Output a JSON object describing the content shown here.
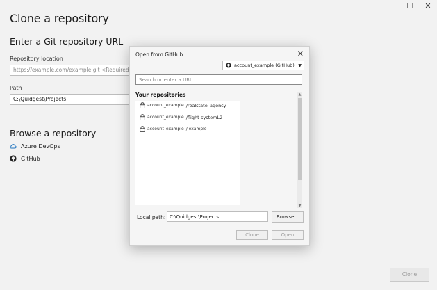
{
  "window": {
    "title": "Clone a repository",
    "minimize_glyph": "☐",
    "close_glyph": "✕"
  },
  "url_section": {
    "heading": "Enter a Git repository URL",
    "repo_location_label": "Repository location",
    "repo_location_placeholder": "https://example.com/example.git <Required>",
    "path_label": "Path",
    "path_value": "C:\\Quidgest\\Projects"
  },
  "browse_section": {
    "heading": "Browse a repository",
    "items": [
      {
        "label": "Azure DevOps",
        "icon": "cloud-icon"
      },
      {
        "label": "GitHub",
        "icon": "github-icon"
      }
    ]
  },
  "clone_button_label": "Clone",
  "dialog": {
    "title": "Open from GitHub",
    "account_selector": "account_example (GitHub)",
    "search_placeholder": "Search or enter a URL",
    "repositories_heading": "Your repositories",
    "repositories": [
      {
        "owner": "account_example",
        "name": "/realstate_agency"
      },
      {
        "owner": "account_example",
        "name": "/flight-systemL2"
      },
      {
        "owner": "account_example",
        "name": "/ example"
      }
    ],
    "local_path_label": "Local path:",
    "local_path_value": "C:\\Quidgest\\Projects",
    "browse_label": "Browse...",
    "clone_label": "Clone",
    "open_label": "Open"
  }
}
